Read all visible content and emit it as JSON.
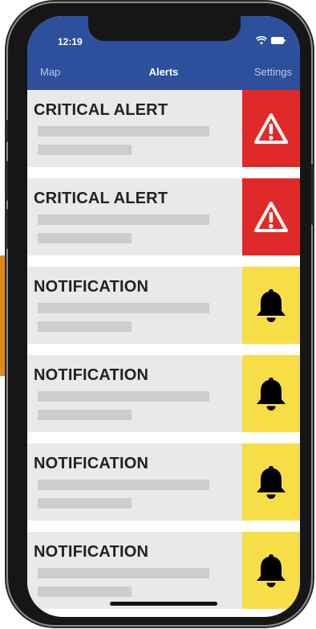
{
  "status": {
    "time": "12:19"
  },
  "tabs": {
    "left": "Map",
    "center": "Alerts",
    "right": "Settings"
  },
  "alerts": [
    {
      "title": "CRITICAL ALERT",
      "type": "critical",
      "icon": "warning-icon",
      "color": "#e02a2a"
    },
    {
      "title": "CRITICAL ALERT",
      "type": "critical",
      "icon": "warning-icon",
      "color": "#e02a2a"
    },
    {
      "title": "NOTIFICATION",
      "type": "notification",
      "icon": "bell-icon",
      "color": "#f7de47"
    },
    {
      "title": "NOTIFICATION",
      "type": "notification",
      "icon": "bell-icon",
      "color": "#f7de47"
    },
    {
      "title": "NOTIFICATION",
      "type": "notification",
      "icon": "bell-icon",
      "color": "#f7de47"
    },
    {
      "title": "NOTIFICATION",
      "type": "notification",
      "icon": "bell-icon",
      "color": "#f7de47"
    }
  ],
  "colors": {
    "header": "#2e4f9b",
    "card_bg": "#e9e9e9",
    "placeholder_bar": "#cdcdcd",
    "critical": "#e02a2a",
    "notification": "#f7de47"
  }
}
